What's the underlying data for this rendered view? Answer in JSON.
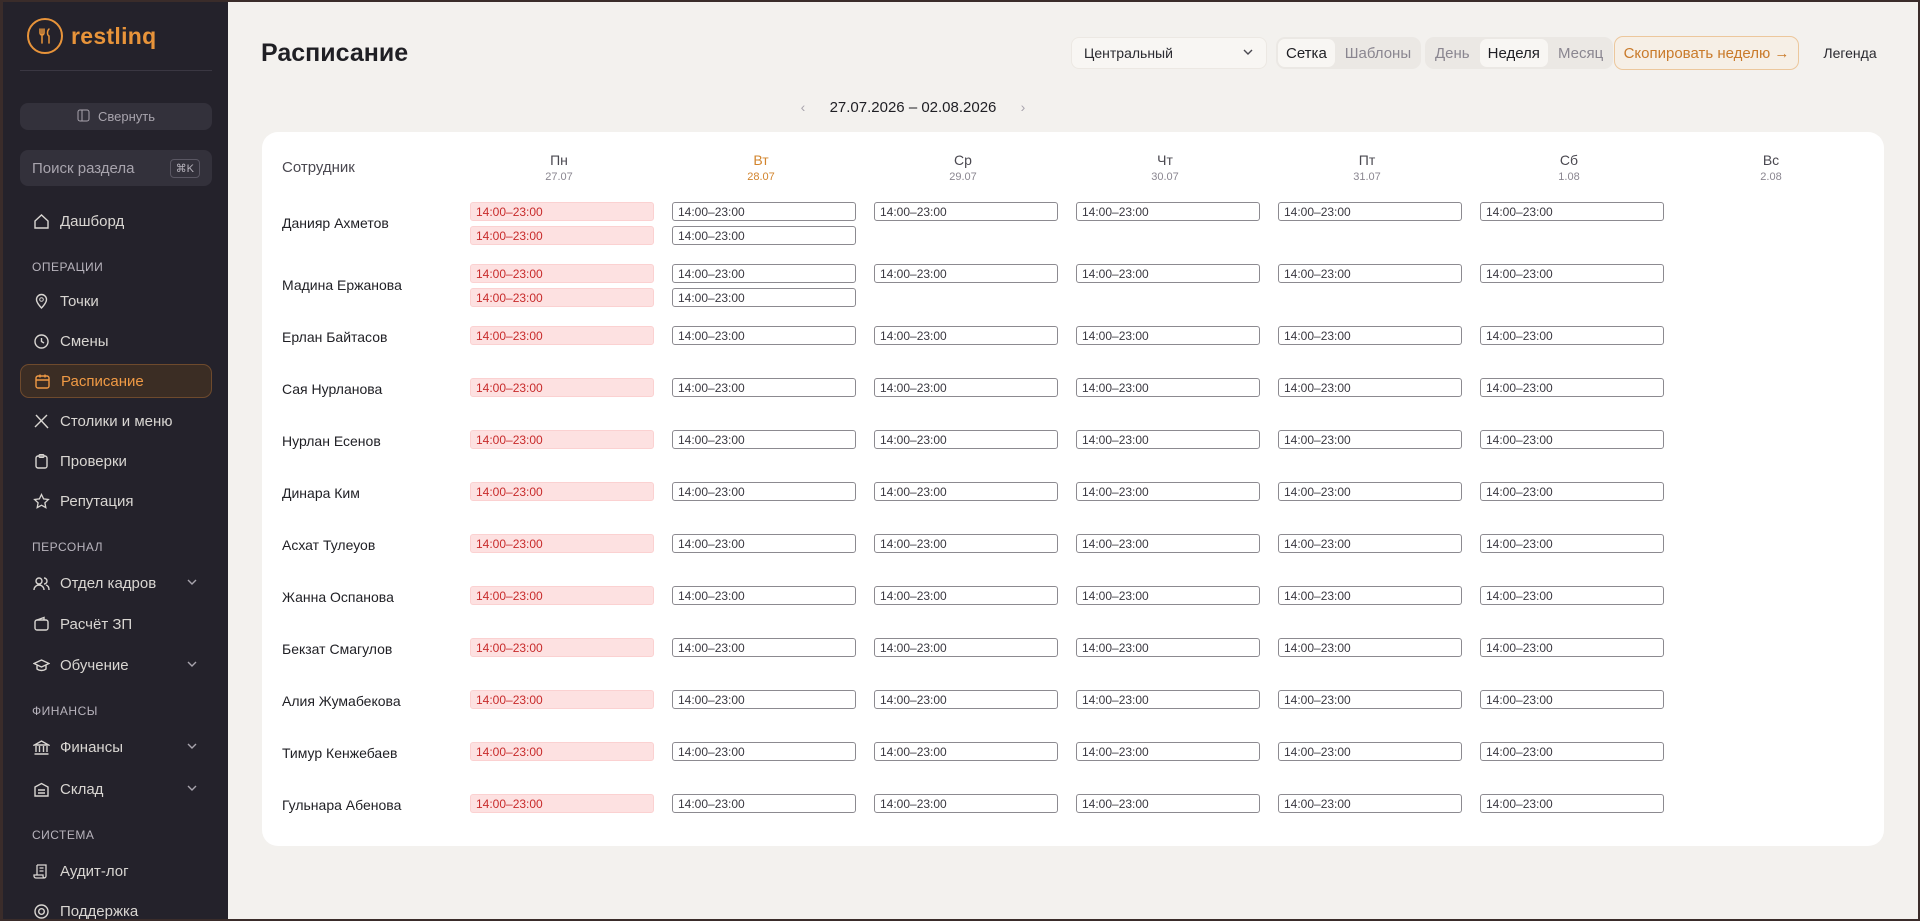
{
  "sidebar": {
    "brand": "restlinq",
    "collapse_label": "Свернуть",
    "search_placeholder": "Поиск раздела",
    "search_shortcut": "⌘K",
    "items": {
      "dashboard": "Дашборд",
      "points": "Точки",
      "shifts": "Смены",
      "schedule": "Расписание",
      "tables_menu": "Столики и меню",
      "checks": "Проверки",
      "reputation": "Репутация",
      "hr": "Отдел кадров",
      "payroll": "Расчёт ЗП",
      "training": "Обучение",
      "finance": "Финансы",
      "warehouse": "Склад",
      "audit": "Аудит-лог",
      "support": "Поддержка"
    },
    "sections": {
      "operations": "ОПЕРАЦИИ",
      "staff": "ПЕРСОНАЛ",
      "finance": "ФИНАНСЫ",
      "system": "СИСТЕМА"
    }
  },
  "header": {
    "title": "Расписание",
    "location": "Центральный",
    "view_grid": "Сетка",
    "view_templates": "Шаблоны",
    "period_day": "День",
    "period_week": "Неделя",
    "period_month": "Месяц",
    "copy_week": "Скопировать неделю →",
    "legend": "Легенда",
    "week_range": "27.07.2026 – 02.08.2026"
  },
  "grid": {
    "employee_header": "Сотрудник",
    "days": [
      {
        "d": "Пн",
        "n": "27.07"
      },
      {
        "d": "Вт",
        "n": "28.07"
      },
      {
        "d": "Ср",
        "n": "29.07"
      },
      {
        "d": "Чт",
        "n": "30.07"
      },
      {
        "d": "Пт",
        "n": "31.07"
      },
      {
        "d": "Сб",
        "n": "1.08"
      },
      {
        "d": "Вс",
        "n": "2.08"
      }
    ],
    "shift_text": "14:00–23:00",
    "employees": [
      {
        "name": "Данияр Ахметов"
      },
      {
        "name": "Мадина Ержанова"
      },
      {
        "name": "Ерлан Байтасов"
      },
      {
        "name": "Сая Нурланова"
      },
      {
        "name": "Нурлан Есенов"
      },
      {
        "name": "Динара Ким"
      },
      {
        "name": "Асхат Тулеуов"
      },
      {
        "name": "Жанна Оспанова"
      },
      {
        "name": "Бекзат Смагулов"
      },
      {
        "name": "Алия Жумабекова"
      },
      {
        "name": "Тимур Кенжебаев"
      },
      {
        "name": "Гульнара Абенова"
      }
    ]
  },
  "colors": {
    "accent": "#e8943a",
    "sidebar_bg": "#24222b",
    "conflict_bg": "#fde1e1",
    "conflict_text": "#c82b2b"
  }
}
